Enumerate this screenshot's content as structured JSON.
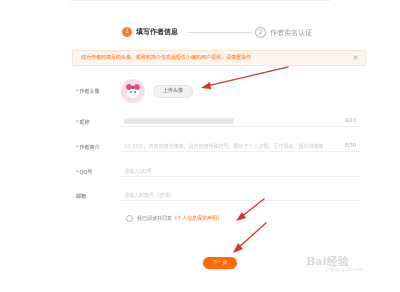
{
  "steps": [
    {
      "num": "1",
      "label": "填写作者信息"
    },
    {
      "num": "2",
      "label": "作者实名认证"
    }
  ],
  "notice": {
    "text": "成为作者时填写的头像、昵称和简介信息最短仅小编的用户视频，请慎重操作",
    "close": "×"
  },
  "form": {
    "avatar_label": "作者头像",
    "upload_label": "上传头像",
    "nickname_label": "昵称",
    "nickname_count": "9/10",
    "intro_label": "作者简介",
    "intro_placeholder": "10-30字，内容应简洁精准，请勿使用特殊符号，展示于个人详情，写作领域，擅长领域等",
    "intro_count": "8/30",
    "qq_label": "QQ号",
    "qq_placeholder": "请输入QQ号",
    "email_label": "邮箱",
    "email_placeholder": "请输入邮箱号（选填）",
    "required_mark": "*"
  },
  "agreement": {
    "prefix": "我已阅读并同意",
    "link": "《个人信息保护声明》"
  },
  "next_button": "下一步",
  "watermark": {
    "brand": "Bai经验",
    "sub": "jingyan.baidu.com"
  },
  "colors": {
    "accent": "#ff6a00",
    "annotation": "#d93232"
  }
}
